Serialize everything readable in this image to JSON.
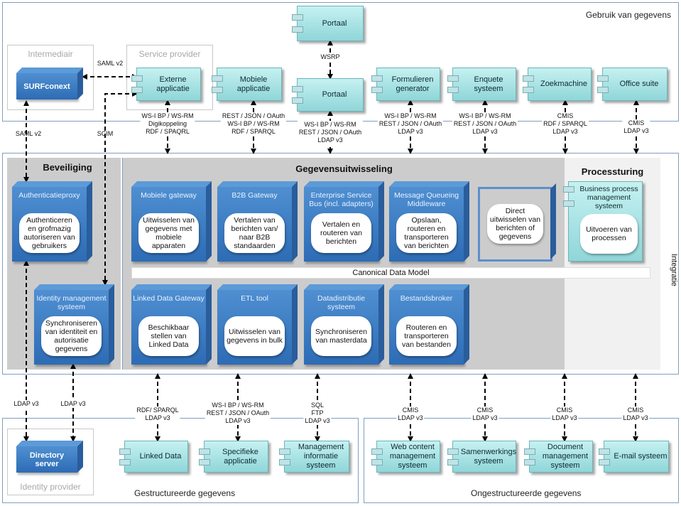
{
  "regions": {
    "usage": "Gebruik van gegevens",
    "integration": "Integratie",
    "structured": "Gestructureerde gegevens",
    "unstructured": "Ongestructureerde gegevens",
    "intermediary": "Intermediair",
    "service_provider": "Service provider",
    "identity_provider": "Identity provider"
  },
  "columns": {
    "security": "Beveiliging",
    "exchange": "Gegevensuitwisseling",
    "process": "Processturing"
  },
  "canonical_data_model": "Canonical Data Model",
  "components": [
    {
      "id": "portaal-top",
      "label": "Portaal"
    },
    {
      "id": "portaal",
      "label": "Portaal"
    },
    {
      "id": "externe",
      "label": "Externe applicatie"
    },
    {
      "id": "mobiele",
      "label": "Mobiele applicatie"
    },
    {
      "id": "formulieren",
      "label": "Formulieren generator"
    },
    {
      "id": "enquete",
      "label": "Enquete systeem"
    },
    {
      "id": "zoek",
      "label": "Zoekmachine"
    },
    {
      "id": "office",
      "label": "Office suite"
    },
    {
      "id": "linked",
      "label": "Linked Data"
    },
    {
      "id": "specifieke",
      "label": "Specifieke applicatie"
    },
    {
      "id": "mis",
      "label": "Management informatie systeem"
    },
    {
      "id": "wcm",
      "label": "Web content management systeem"
    },
    {
      "id": "samen",
      "label": "Samenwerkings systeem"
    },
    {
      "id": "dms",
      "label": "Document management systeem"
    },
    {
      "id": "email",
      "label": "E-mail systeem"
    }
  ],
  "servers": [
    {
      "id": "surf",
      "label": "SURFconext"
    },
    {
      "id": "directory",
      "label": "Directory server"
    }
  ],
  "nodes": [
    {
      "id": "authproxy",
      "title": "Authenticatieproxy",
      "desc": "Authenticeren en grofmazig autoriseren van gebruikers"
    },
    {
      "id": "idm",
      "title": "Identity management systeem",
      "desc": "Synchroniseren van identiteit en autorisatie gegevens"
    },
    {
      "id": "mobgw",
      "title": "Mobiele gateway",
      "desc": "Uitwisselen van gegevens met mobiele apparaten"
    },
    {
      "id": "b2b",
      "title": "B2B Gateway",
      "desc": "Vertalen van berichten van/ naar B2B standaarden"
    },
    {
      "id": "esb",
      "title": "Enterprise Service Bus (incl. adapters)",
      "desc": "Vertalen en routeren van berichten"
    },
    {
      "id": "mq",
      "title": "Message Queueing Middleware",
      "desc": "Opslaan, routeren en transporteren van berichten"
    },
    {
      "id": "direct",
      "title": "",
      "desc": "Direct uitwisselen van berichten of gegevens"
    },
    {
      "id": "ldgw",
      "title": "Linked Data Gateway",
      "desc": "Beschikbaar stellen van Linked Data"
    },
    {
      "id": "etl",
      "title": "ETL tool",
      "desc": "Uitwisselen van gegevens in bulk"
    },
    {
      "id": "ddist",
      "title": "Datadistributie systeem",
      "desc": "Synchroniseren van masterdata"
    },
    {
      "id": "bestand",
      "title": "Bestandsbroker",
      "desc": "Routeren en transporteren van bestanden"
    }
  ],
  "bpm": {
    "title": "Business process management systeem",
    "desc": "Uitvoeren van processen"
  },
  "protocols": [
    {
      "id": "saml-h",
      "text": "SAML v2"
    },
    {
      "id": "saml-v",
      "text": "SAML v2"
    },
    {
      "id": "scim",
      "text": "SCIM"
    },
    {
      "id": "wsrp",
      "text": "WSRP"
    },
    {
      "id": "p-externe",
      "text": "WS-I BP / WS-RM\nDigikoppeling\nRDF / SPAQRL"
    },
    {
      "id": "p-mobiele",
      "text": "REST / JSON / OAuth\nWS-I BP / WS-RM\nRDF / SPARQL"
    },
    {
      "id": "p-portaal",
      "text": "WS-I BP / WS-RM\nREST / JSON / OAuth\nLDAP v3"
    },
    {
      "id": "p-form",
      "text": "WS-I BP / WS-RM\nREST / JSON / OAuth\nLDAP v3"
    },
    {
      "id": "p-enq",
      "text": "WS-I BP / WS-RM\nREST / JSON / OAuth\nLDAP v3"
    },
    {
      "id": "p-zoek",
      "text": "CMIS\nRDF / SPARQL\nLDAP v3"
    },
    {
      "id": "p-office",
      "text": "CMIS\nLDAP v3"
    },
    {
      "id": "p-ldap1",
      "text": "LDAP v3"
    },
    {
      "id": "p-ldap2",
      "text": "LDAP v3"
    },
    {
      "id": "p-linked",
      "text": "RDF/ SPARQL\nLDAP v3"
    },
    {
      "id": "p-spec",
      "text": "WS-I BP / WS-RM\nREST / JSON / OAuth\nLDAP v3"
    },
    {
      "id": "p-mis",
      "text": "SQL\nFTP\nLDAP v3"
    },
    {
      "id": "p-wcm",
      "text": "CMIS\nLDAP v3"
    },
    {
      "id": "p-samen",
      "text": "CMIS\nLDAP v3"
    },
    {
      "id": "p-dms",
      "text": "CMIS\nLDAP v3"
    },
    {
      "id": "p-email",
      "text": "CMIS\nLDAP v3"
    }
  ],
  "colors": {
    "node_blue": "#3a7cc4",
    "component_teal": "#a9e4e6",
    "panel_gray": "#cccccc",
    "border_blue": "#7f9fbf"
  }
}
